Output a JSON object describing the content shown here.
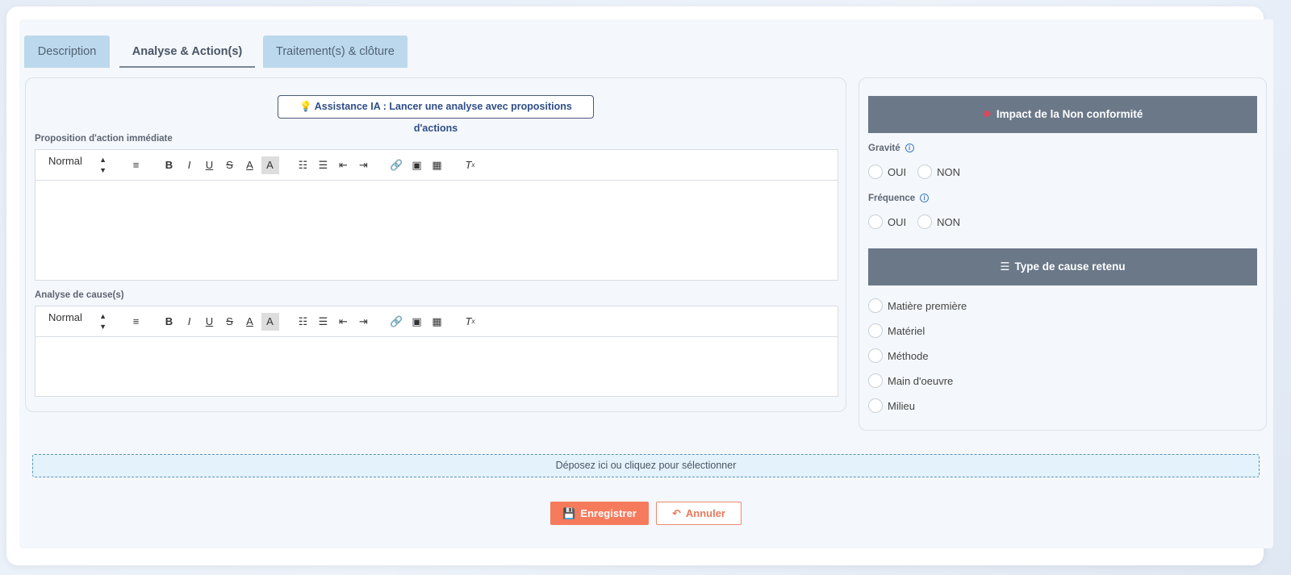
{
  "tabs": [
    {
      "label": "Description"
    },
    {
      "label": "Analyse & Action(s)"
    },
    {
      "label": "Traitement(s) & clôture"
    }
  ],
  "ai_button": {
    "label": "Assistance IA : Lancer une analyse avec propositions d'actions"
  },
  "editors": {
    "immediate_action": {
      "label": "Proposition d'action immédiate",
      "format": "Normal"
    },
    "cause_analysis": {
      "label": "Analyse de cause(s)",
      "format": "Normal"
    }
  },
  "impact": {
    "title": "Impact de la Non conformité",
    "gravite": {
      "label": "Gravité",
      "options": [
        "OUI",
        "NON"
      ]
    },
    "frequence": {
      "label": "Fréquence",
      "options": [
        "OUI",
        "NON"
      ]
    }
  },
  "cause_type": {
    "title": "Type de cause retenu",
    "options": [
      "Matière première",
      "Matériel",
      "Méthode",
      "Main d'oeuvre",
      "Milieu"
    ]
  },
  "dropzone": {
    "label": "Déposez ici ou cliquez pour sélectionner"
  },
  "actions": {
    "save": "Enregistrer",
    "cancel": "Annuler"
  },
  "colors": {
    "accent": "#f67a5c",
    "section_header": "#6a7888",
    "tab_inactive": "#bcd8ec"
  }
}
